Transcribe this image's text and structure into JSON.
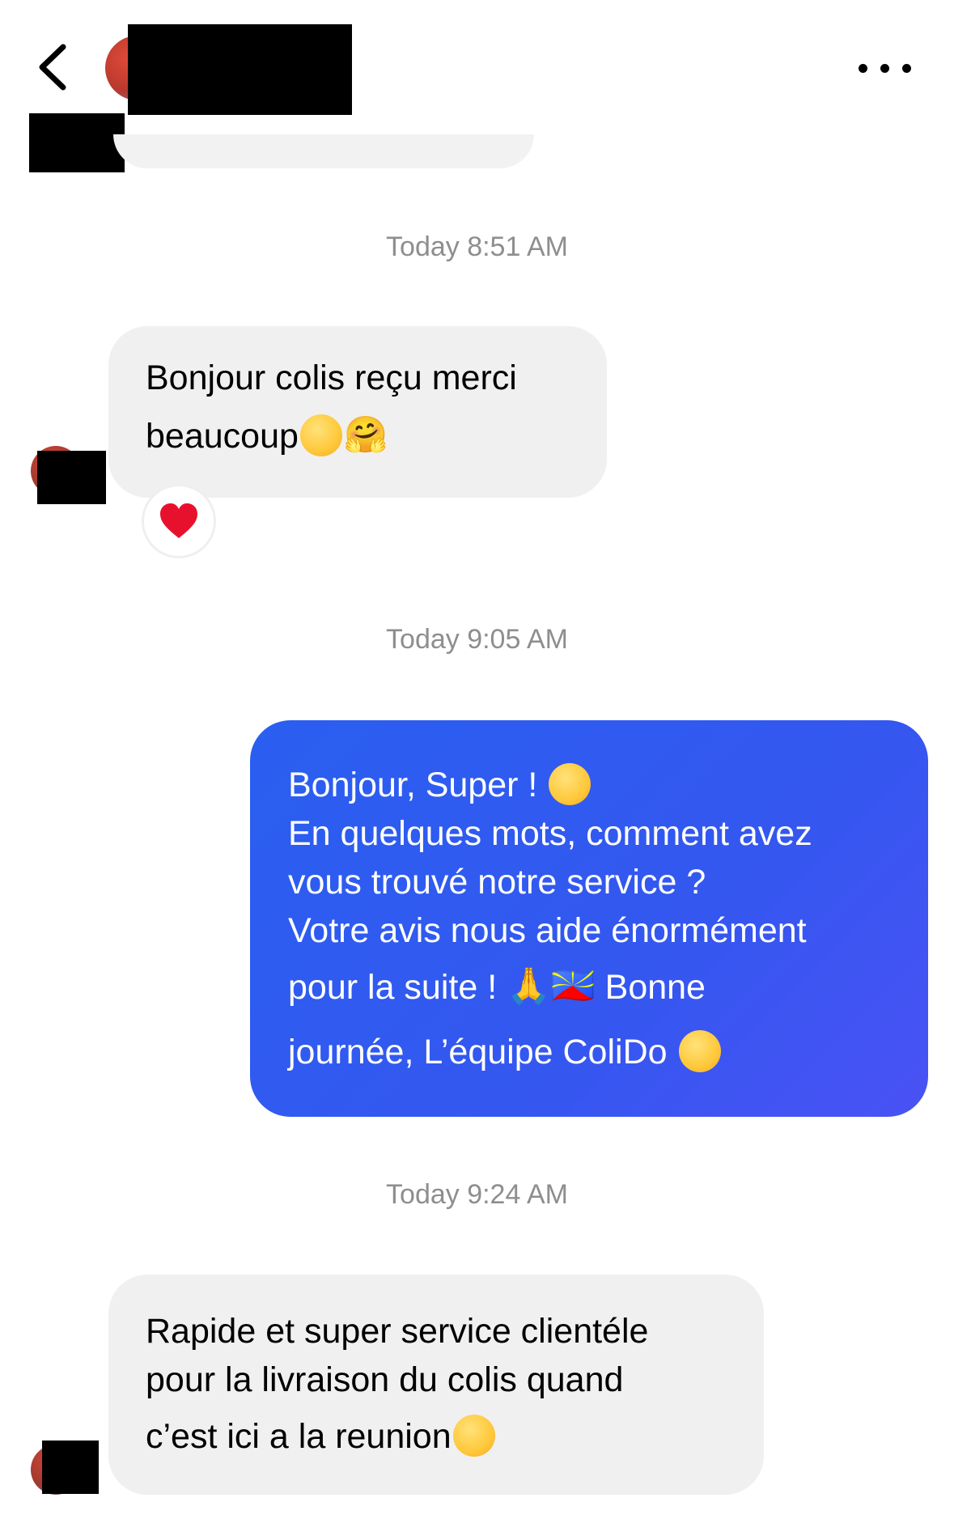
{
  "header": {
    "back_icon": "chevron-left-icon",
    "more_icon": "more-horizontal-icon"
  },
  "colors": {
    "incoming_bubble": "#f0f0f0",
    "outgoing_bubble": "#3157f0",
    "timestamp": "#8e8e8e",
    "reaction_heart": "#e8112d"
  },
  "conversation": {
    "timestamps": [
      "Today 8:51 AM",
      "Today 9:05 AM",
      "Today 9:24 AM"
    ],
    "message1": {
      "line1": "Bonjour colis reçu merci",
      "line2": "beaucoup",
      "emoji_a": "☺️",
      "emoji_b": "🤗",
      "reaction": "❤️"
    },
    "message2": {
      "line1": "Bonjour, Super ! ",
      "emoji_a": "😊",
      "line2": "En quelques mots, comment avez",
      "line3": "vous trouvé notre service ?",
      "line4": "Votre avis nous aide énormément",
      "line5": "pour la suite ! ",
      "emoji_b": "🙏",
      "emoji_flag": "🇷🇪",
      "line5_end": " Bonne",
      "line6": "journée, L’équipe ColiDo ",
      "emoji_c": "🙂"
    },
    "message3": {
      "line1": "Rapide et super service clientéle",
      "line2": "pour la livraison du colis quand",
      "line3": "c’est ici a la reunion",
      "emoji_a": "☺️"
    }
  }
}
